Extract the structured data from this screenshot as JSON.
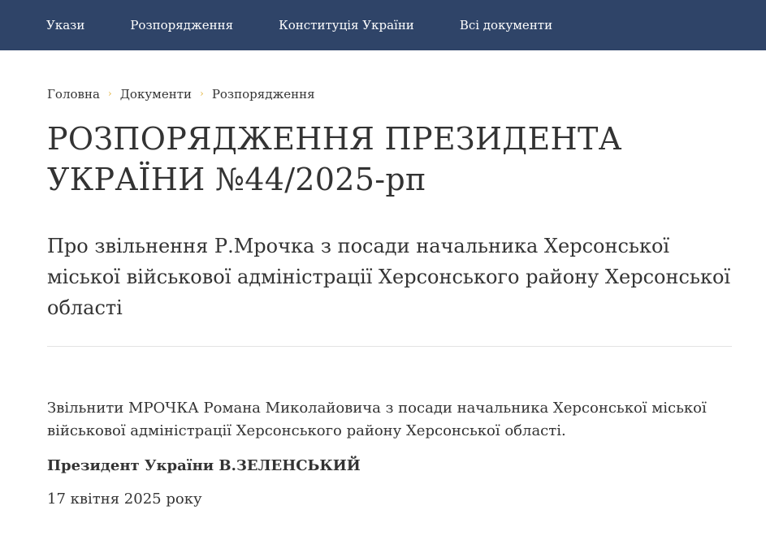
{
  "nav": {
    "items": [
      {
        "label": "Укази"
      },
      {
        "label": "Розпорядження"
      },
      {
        "label": "Конституція України"
      },
      {
        "label": "Всі документи"
      }
    ]
  },
  "breadcrumb": {
    "items": [
      "Головна",
      "Документи",
      "Розпорядження"
    ],
    "separator": "›"
  },
  "document": {
    "title": "РОЗПОРЯДЖЕННЯ ПРЕЗИДЕНТА УКРАЇНИ №44/2025-рп",
    "subtitle": "Про звільнення Р.Мрочка з посади начальника Херсонської міської військової адміністрації Херсонського району Херсонської області",
    "body": "Звільнити МРОЧКА Романа Миколайовича з посади начальника Херсонської міської військової адміністрації Херсонського району Херсонської області.",
    "signature": "Президент України В.ЗЕЛЕНСЬКИЙ",
    "date": "17 квітня 2025 року"
  },
  "colors": {
    "nav_bg": "#2f4468",
    "breadcrumb_separator": "#e3b43c"
  }
}
